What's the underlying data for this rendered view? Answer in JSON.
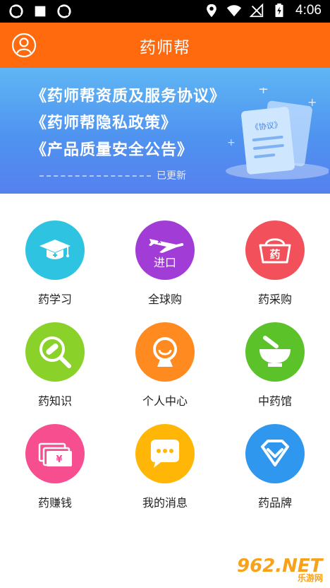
{
  "status_bar": {
    "time": "4:06",
    "left_icons": [
      "sync-icon",
      "square-icon",
      "sync-icon"
    ],
    "right_icons": [
      "location-icon",
      "wifi-icon",
      "no-sim-icon",
      "battery-charging-icon"
    ]
  },
  "header": {
    "title": "药师帮",
    "avatar_icon": "user-icon",
    "color": "#ff6a0f"
  },
  "banner": {
    "links": [
      "《药师帮资质及服务协议》",
      "《药师帮隐私政策》",
      "《产品质量安全公告》"
    ],
    "updated": "已更新",
    "doc_label": "《协议》"
  },
  "grid": {
    "items": [
      {
        "label": "药学习",
        "icon": "graduation-cap-icon",
        "color": "#2fc3e2"
      },
      {
        "label": "全球购",
        "icon": "airplane-icon",
        "icon_text": "进口",
        "color": "#a23cd6"
      },
      {
        "label": "药采购",
        "icon": "basket-icon",
        "icon_text": "药",
        "color": "#f2505a"
      },
      {
        "label": "药知识",
        "icon": "magnifier-pill-icon",
        "color": "#8ad12a"
      },
      {
        "label": "个人中心",
        "icon": "webcam-person-icon",
        "color": "#ff8a1f"
      },
      {
        "label": "中药馆",
        "icon": "mortar-icon",
        "color": "#5cc22a"
      },
      {
        "label": "药赚钱",
        "icon": "money-icon",
        "color": "#f64e8e"
      },
      {
        "label": "我的消息",
        "icon": "chat-bubble-icon",
        "color": "#ffb606"
      },
      {
        "label": "药品牌",
        "icon": "diamond-icon",
        "color": "#2f98ee"
      }
    ]
  },
  "watermark": {
    "big": "962.NET",
    "small": "乐游网"
  }
}
